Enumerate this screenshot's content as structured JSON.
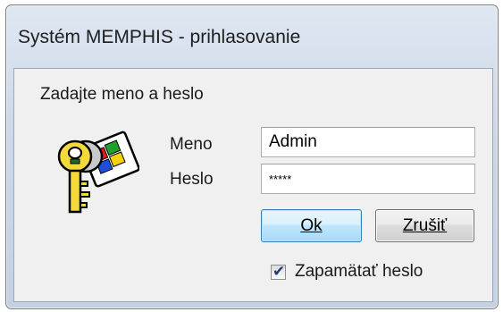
{
  "window": {
    "title": "Systém MEMPHIS - prihlasovanie"
  },
  "dialog": {
    "prompt": "Zadajte meno a heslo",
    "icon": "keys-and-windows-logo-icon",
    "username": {
      "label": "Meno",
      "value": "Admin"
    },
    "password": {
      "label": "Heslo",
      "value": "*****"
    },
    "buttons": {
      "ok_label": "Ok",
      "cancel_label": "Zrušiť"
    },
    "remember": {
      "label": "Zapamätať heslo",
      "checked": true
    }
  },
  "colors": {
    "title_bar": "#cdd9e8",
    "client_bg": "#f0f0f0",
    "default_button_border": "#3c7fb1"
  }
}
